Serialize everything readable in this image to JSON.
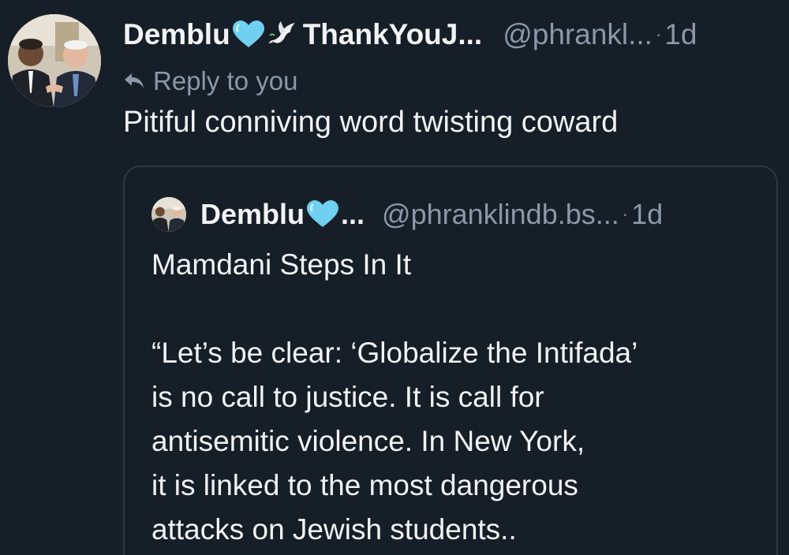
{
  "post": {
    "author_name": "Demblu",
    "author_name_rest": "ThankYouJ...",
    "handle": "@phrankl...",
    "separator": "·",
    "time": "1d",
    "reply_label": "Reply to you",
    "text": "Pitiful conniving word twisting coward",
    "icons": [
      "avatar-photo",
      "blue-heart-icon",
      "dove-icon",
      "reply-arrow-icon"
    ]
  },
  "quote": {
    "author_name": "Demblu",
    "ellipsis": "...",
    "handle": "@phranklindb.bs...",
    "time": "1d",
    "lines": [
      "Mamdani Steps In It",
      "",
      "“Let’s be clear: ‘Globalize the Intifada’",
      "is no call to justice. It is call for",
      "antisemitic violence. In New York,",
      "it is linked to the most dangerous",
      "attacks on Jewish students.."
    ]
  },
  "colors": {
    "background": "#161e27",
    "text": "#f1f3f5",
    "muted": "#8b98a8",
    "border": "#2d3846",
    "heart": "#6fd0f0"
  }
}
